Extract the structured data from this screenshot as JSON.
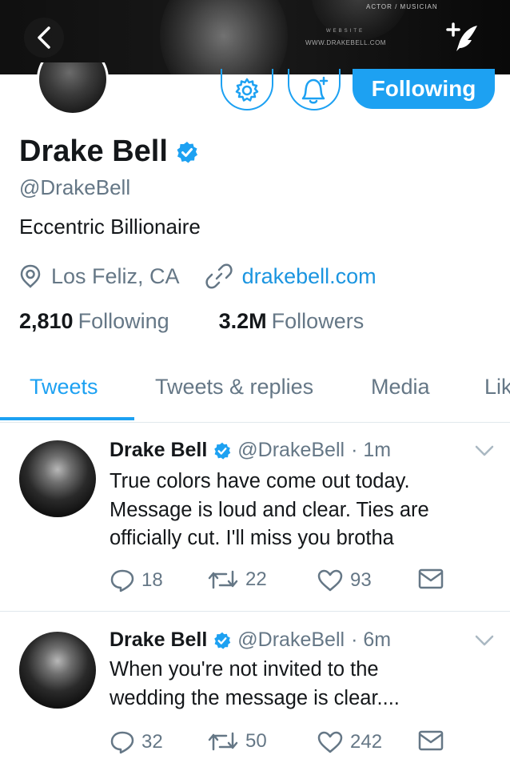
{
  "banner": {
    "tagline": "ACTOR / MUSICIAN",
    "site_label": "WEBSITE",
    "site_url": "WWW.DRAKEBELL.COM"
  },
  "icons": {
    "back": "chevron-left-icon",
    "compose": "quill-plus-icon",
    "settings": "gear-icon",
    "notify": "bell-plus-icon",
    "verified": "verified-badge-icon",
    "location": "location-pin-icon",
    "link": "link-icon",
    "reply": "reply-icon",
    "retweet": "retweet-icon",
    "like": "heart-icon",
    "dm": "envelope-icon",
    "caret": "chevron-down-icon"
  },
  "colors": {
    "accent": "#1da1f2",
    "link": "#1b95e0",
    "muted": "#657786",
    "text": "#14171a"
  },
  "profile": {
    "follow_button": "Following",
    "display_name": "Drake Bell",
    "handle": "@DrakeBell",
    "bio": "Eccentric Billionaire",
    "location": "Los Feliz, CA",
    "website": "drakebell.com",
    "following_count": "2,810",
    "following_label": "Following",
    "followers_count": "3.2M",
    "followers_label": "Followers"
  },
  "tabs": [
    {
      "label": "Tweets",
      "active": true
    },
    {
      "label": "Tweets & replies",
      "active": false
    },
    {
      "label": "Media",
      "active": false
    },
    {
      "label": "Likes",
      "active": false
    }
  ],
  "tweets": [
    {
      "name": "Drake Bell",
      "handle": "@DrakeBell",
      "time": "· 1m",
      "lines": [
        "True colors have come out today.",
        "Message is loud and clear. Ties are",
        "officially cut. I'll miss you brotha"
      ],
      "replies": "18",
      "retweets": "22",
      "likes": "93"
    },
    {
      "name": "Drake Bell",
      "handle": "@DrakeBell",
      "time": "· 6m",
      "lines": [
        "When you're not invited to the",
        "wedding the message is clear...."
      ],
      "replies": "32",
      "retweets": "50",
      "likes": "242"
    }
  ]
}
